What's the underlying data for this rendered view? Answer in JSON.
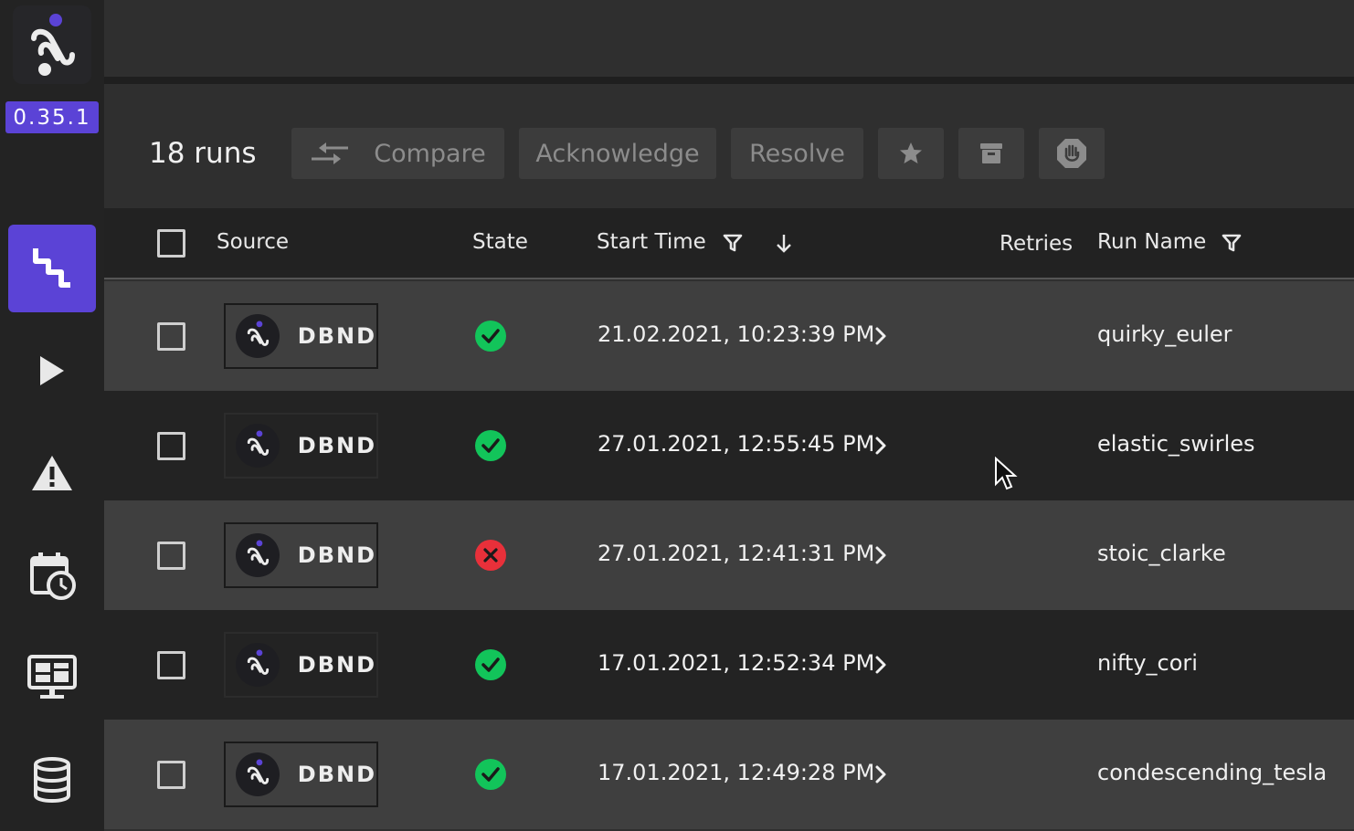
{
  "app": {
    "version": "0.35.1",
    "brand_color": "#5b43d6"
  },
  "sidebar": {
    "items": [
      {
        "name": "runs",
        "icon": "pipeline-icon",
        "active": true
      },
      {
        "name": "play",
        "icon": "play-icon",
        "active": false
      },
      {
        "name": "alerts",
        "icon": "warning-icon",
        "active": false
      },
      {
        "name": "schedule",
        "icon": "calendar-clock-icon",
        "active": false
      },
      {
        "name": "monitor",
        "icon": "monitor-dashboard-icon",
        "active": false
      },
      {
        "name": "datastore",
        "icon": "database-icon",
        "active": false
      }
    ]
  },
  "toolbar": {
    "runs_count": "18 runs",
    "compare_label": "Compare",
    "acknowledge_label": "Acknowledge",
    "resolve_label": "Resolve",
    "star_icon": "star-icon",
    "archive_icon": "archive-icon",
    "stop_icon": "hand-stop-icon"
  },
  "table": {
    "headers": {
      "source": "Source",
      "state": "State",
      "start_time": "Start Time",
      "retries": "Retries",
      "run_name": "Run Name"
    },
    "rows": [
      {
        "source": "DBND",
        "state": "success",
        "start_time": "21.02.2021, 10:23:39 PM",
        "retries": "",
        "run_name": "quirky_euler"
      },
      {
        "source": "DBND",
        "state": "success",
        "start_time": "27.01.2021, 12:55:45 PM",
        "retries": "",
        "run_name": "elastic_swirles"
      },
      {
        "source": "DBND",
        "state": "failed",
        "start_time": "27.01.2021, 12:41:31 PM",
        "retries": "",
        "run_name": "stoic_clarke"
      },
      {
        "source": "DBND",
        "state": "success",
        "start_time": "17.01.2021, 12:52:34 PM",
        "retries": "",
        "run_name": "nifty_cori"
      },
      {
        "source": "DBND",
        "state": "success",
        "start_time": "17.01.2021, 12:49:28 PM",
        "retries": "",
        "run_name": "condescending_tesla"
      }
    ]
  },
  "colors": {
    "success": "#12c45a",
    "failed": "#e8303a"
  }
}
